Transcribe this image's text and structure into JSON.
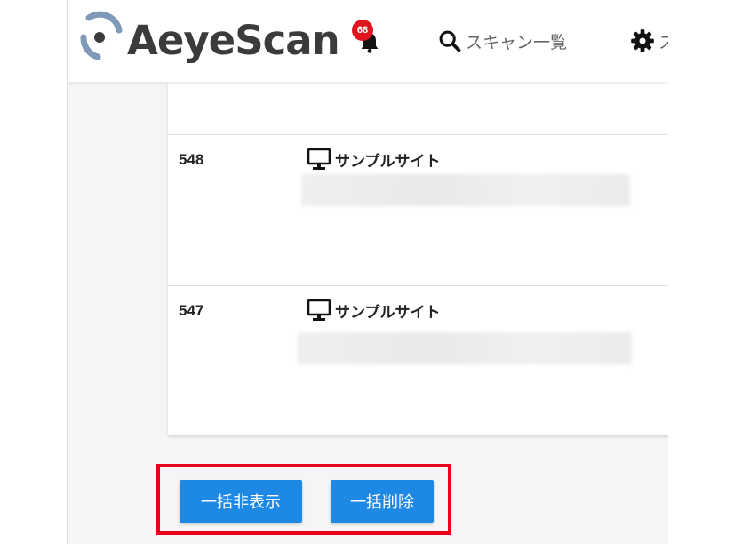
{
  "header": {
    "app_name": "AeyeScan",
    "notification_count": "68",
    "nav_scan_label": "スキャン一覧",
    "nav_settings_label_partial": "ス"
  },
  "rows": [
    {
      "id": "548",
      "site_name": "サンプルサイト"
    },
    {
      "id": "547",
      "site_name": "サンプルサイト"
    }
  ],
  "actions": {
    "bulk_hide_label": "一括非表示",
    "bulk_delete_label": "一括削除"
  },
  "colors": {
    "primary_button": "#1e88e5",
    "highlight_border": "#e8001c",
    "badge": "#e0141e",
    "logo_accent": "#7e9ab8"
  }
}
